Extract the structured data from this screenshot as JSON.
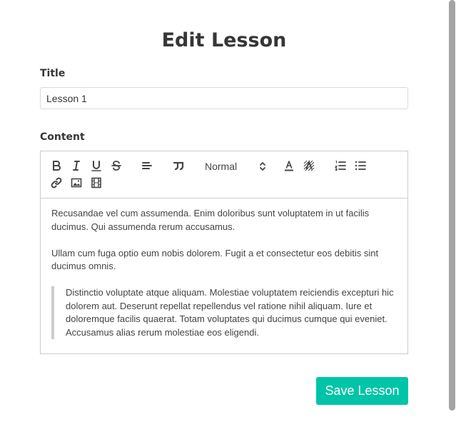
{
  "page": {
    "title": "Edit Lesson"
  },
  "form": {
    "title_label": "Title",
    "title_value": "Lesson 1",
    "content_label": "Content",
    "save_label": "Save Lesson"
  },
  "editor": {
    "toolbar": {
      "buttons": [
        "bold-icon",
        "italic-icon",
        "underline-icon",
        "strikethrough-icon",
        "align-left-icon",
        "blockquote-icon",
        "font-color-icon",
        "background-color-icon",
        "ordered-list-icon",
        "bullet-list-icon",
        "link-icon",
        "image-icon",
        "video-icon"
      ],
      "format_value": "Normal"
    },
    "paragraphs": [
      "Recusandae vel cum assumenda. Enim doloribus sunt voluptatem in ut facilis ducimus. Qui assumenda rerum accusamus.",
      "Ullam cum fuga optio eum nobis dolorem. Fugit a et consectetur eos debitis sint ducimus omnis."
    ],
    "blockquote": "Distinctio voluptate atque aliquam. Molestiae voluptatem reiciendis excepturi hic dolorem aut. Deserunt repellat repellendus vel ratione nihil aliquam. Iure et doloremque facilis quaerat. Totam voluptates qui ducimus cumque qui eveniet. Accusamus alias rerum molestiae eos eligendi."
  },
  "colors": {
    "accent": "#00c4a7",
    "border": "#cccccc",
    "text": "#363636"
  }
}
